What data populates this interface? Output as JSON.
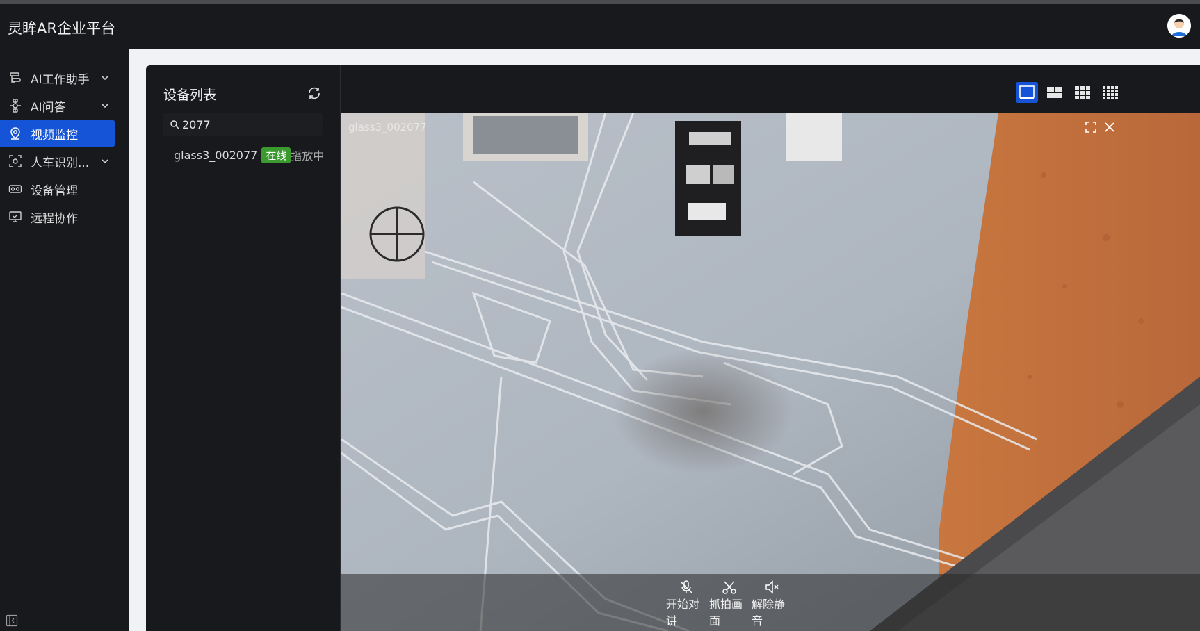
{
  "app": {
    "title": "灵眸AR企业平台"
  },
  "sidebar": {
    "items": [
      {
        "label": "AI工作助手",
        "icon": "ai-assistant-icon",
        "expandable": true,
        "active": false
      },
      {
        "label": "AI问答",
        "icon": "ai-qa-icon",
        "expandable": true,
        "active": false
      },
      {
        "label": "视频监控",
        "icon": "video-monitor-icon",
        "expandable": false,
        "active": true
      },
      {
        "label": "人车识别...",
        "icon": "recognition-icon",
        "expandable": true,
        "active": false
      },
      {
        "label": "设备管理",
        "icon": "device-icon",
        "expandable": false,
        "active": false
      },
      {
        "label": "远程协作",
        "icon": "remote-icon",
        "expandable": false,
        "active": false
      }
    ]
  },
  "device_list": {
    "title": "设备列表",
    "search": {
      "value": "2077",
      "placeholder": ""
    },
    "devices": [
      {
        "name": "glass3_002077",
        "badge": "在线",
        "status": "播放中"
      }
    ]
  },
  "layouts": [
    "1x1",
    "2+1",
    "3x3",
    "4x4"
  ],
  "active_layout": "1x1",
  "video": {
    "title": "glass3_002077",
    "controls": [
      {
        "label": "开始对讲",
        "icon": "mic-off-icon"
      },
      {
        "label": "抓拍画面",
        "icon": "scissors-icon"
      },
      {
        "label": "解除静音",
        "icon": "speaker-muted-icon"
      }
    ]
  },
  "colors": {
    "accent": "#1554d6",
    "online": "#3a9a2e",
    "background": "#17191c"
  }
}
